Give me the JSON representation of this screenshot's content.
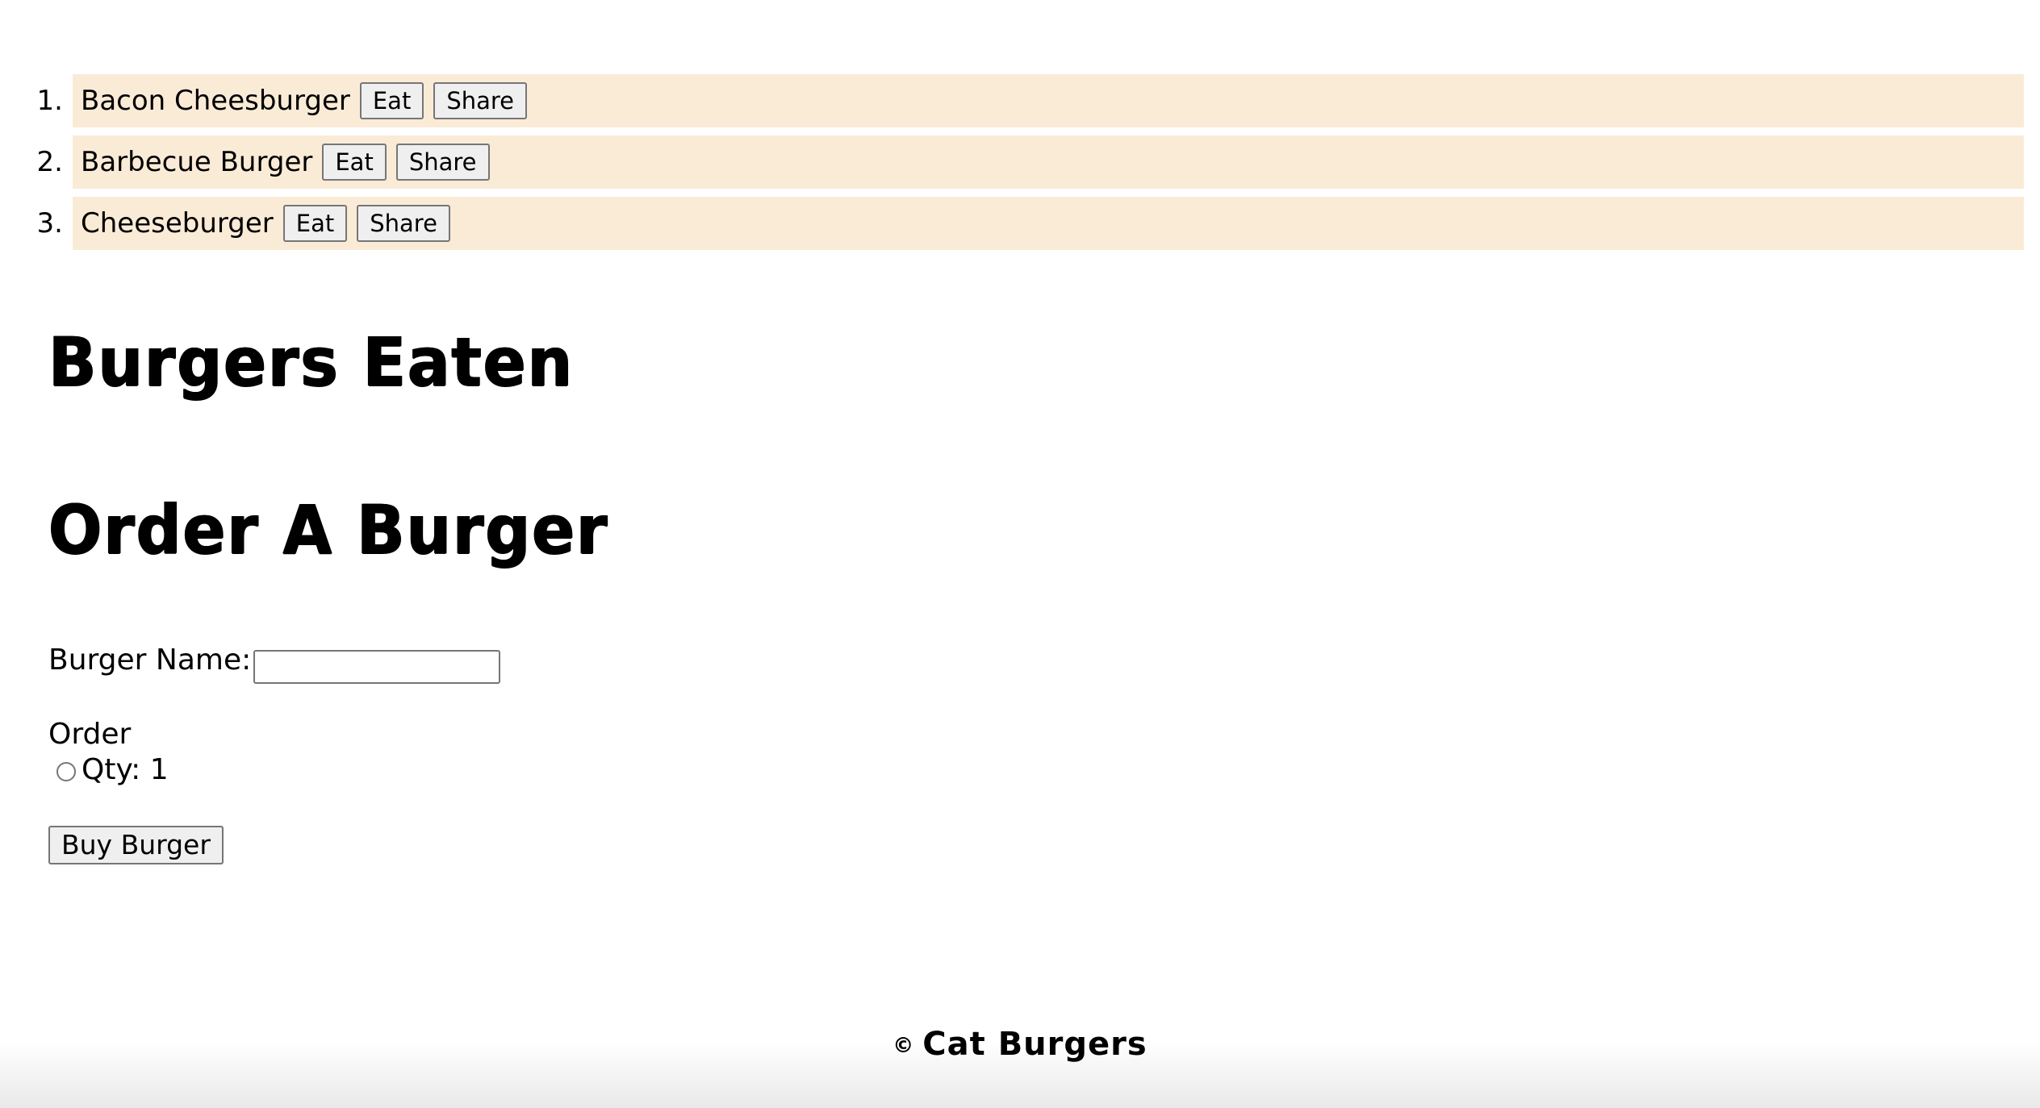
{
  "burgers": [
    {
      "number": "1.",
      "name": "Bacon Cheesburger",
      "eat_label": "Eat",
      "share_label": "Share"
    },
    {
      "number": "2.",
      "name": "Barbecue Burger",
      "eat_label": "Eat",
      "share_label": "Share"
    },
    {
      "number": "3.",
      "name": "Cheeseburger",
      "eat_label": "Eat",
      "share_label": "Share"
    }
  ],
  "eaten_heading": "Burgers Eaten",
  "order_heading": "Order A Burger",
  "form": {
    "name_label": "Burger Name:",
    "name_value": "",
    "order_label": "Order",
    "qty_label": "Qty: 1",
    "buy_label": "Buy Burger"
  },
  "footer": {
    "copyright_symbol": "©",
    "brand": "Cat Burgers"
  },
  "colors": {
    "row_background": "#faebd7",
    "button_background": "#efefef"
  }
}
